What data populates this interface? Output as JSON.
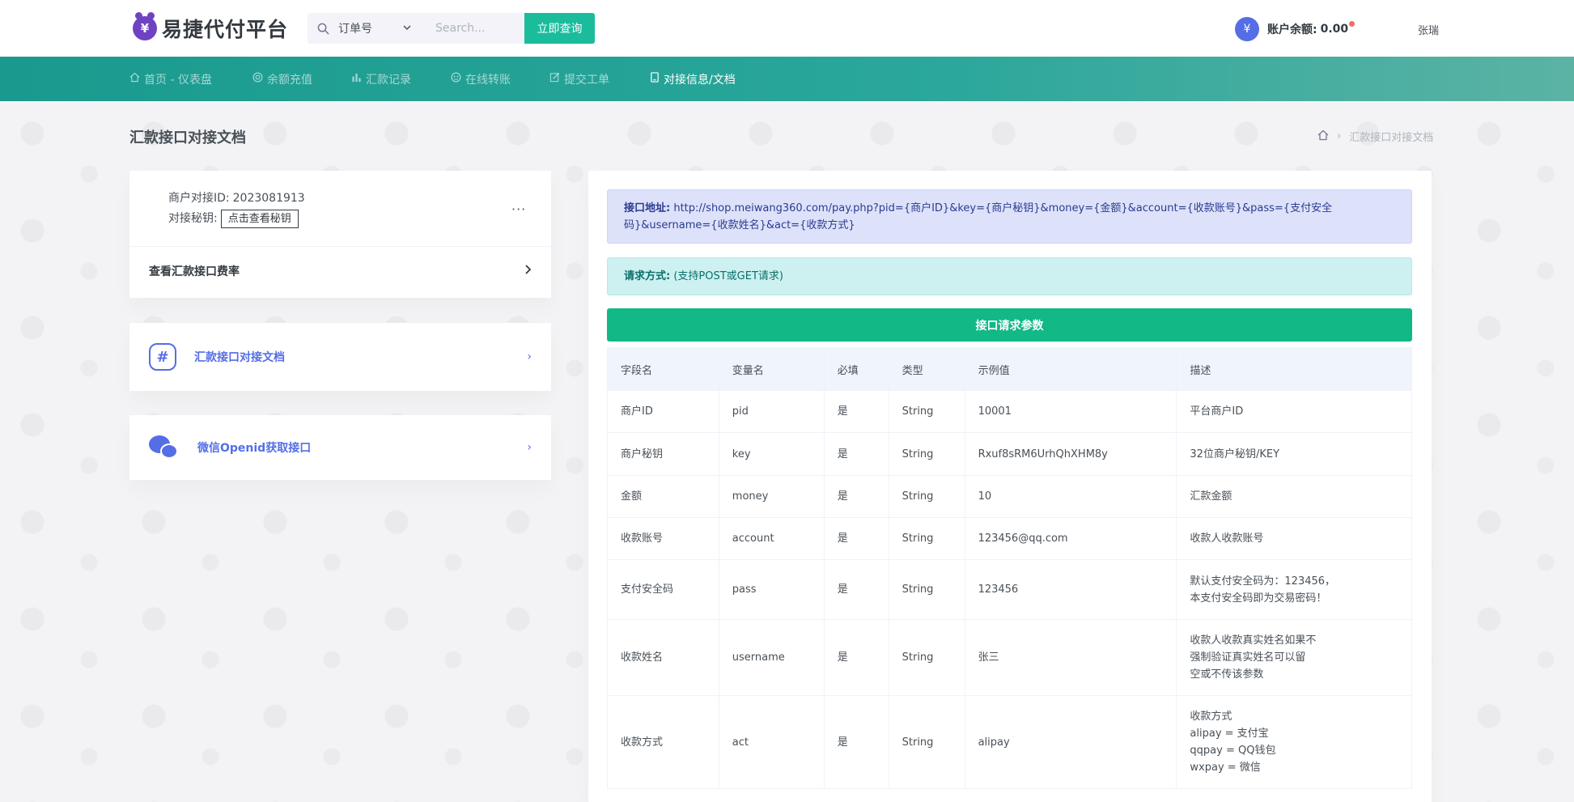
{
  "header": {
    "logo_text": "易捷代付平台",
    "search_select": "订单号",
    "search_placeholder": "Search...",
    "search_button": "立即查询",
    "balance_label": "账户余额:",
    "balance_value": "0.00",
    "user_name": "张瑞"
  },
  "nav": [
    {
      "label": "首页 - 仪表盘",
      "icon": "home-icon"
    },
    {
      "label": "余额充值",
      "icon": "coin-icon"
    },
    {
      "label": "汇款记录",
      "icon": "bar-chart-icon"
    },
    {
      "label": "在线转账",
      "icon": "transfer-icon"
    },
    {
      "label": "提交工单",
      "icon": "edit-icon"
    },
    {
      "label": "对接信息/文档",
      "icon": "document-icon"
    }
  ],
  "page": {
    "title": "汇款接口对接文档",
    "breadcrumb_current": "汇款接口对接文档"
  },
  "merchant": {
    "id_label": "商户对接ID:",
    "id_value": "2023081913",
    "secret_label": "对接秘钥:",
    "secret_button": "点击查看秘钥",
    "rate_label": "查看汇款接口费率"
  },
  "links": {
    "doc_label": "汇款接口对接文档",
    "openid_label": "微信Openid获取接口"
  },
  "api": {
    "addr_label": "接口地址:",
    "addr_value": "http://shop.meiwang360.com/pay.php?pid={商户ID}&key={商户秘钥}&money={金额}&account={收款账号}&pass={支付安全码}&username={收款姓名}&act={收款方式}",
    "method_label": "请求方式:",
    "method_value": "(支持POST或GET请求)",
    "params_title": "接口请求参数"
  },
  "table": {
    "headers": [
      "字段名",
      "变量名",
      "必填",
      "类型",
      "示例值",
      "描述"
    ],
    "rows": [
      {
        "field": "商户ID",
        "var": "pid",
        "required": "是",
        "type": "String",
        "example": "10001",
        "desc": [
          "平台商户ID"
        ]
      },
      {
        "field": "商户秘钥",
        "var": "key",
        "required": "是",
        "type": "String",
        "example": "Rxuf8sRM6UrhQhXHM8y",
        "desc": [
          "32位商户秘钥/KEY"
        ]
      },
      {
        "field": "金额",
        "var": "money",
        "required": "是",
        "type": "String",
        "example": "10",
        "desc": [
          "汇款金额"
        ]
      },
      {
        "field": "收款账号",
        "var": "account",
        "required": "是",
        "type": "String",
        "example": "123456@qq.com",
        "desc": [
          "收款人收款账号"
        ]
      },
      {
        "field": "支付安全码",
        "var": "pass",
        "required": "是",
        "type": "String",
        "example": "123456",
        "desc": [
          "默认支付安全码为：123456，",
          "本支付安全码即为交易密码！"
        ]
      },
      {
        "field": "收款姓名",
        "var": "username",
        "required": "是",
        "type": "String",
        "example": "张三",
        "desc": [
          "收款人收款真实姓名如果不",
          "强制验证真实姓名可以留",
          "空或不传该参数"
        ]
      },
      {
        "field": "收款方式",
        "var": "act",
        "required": "是",
        "type": "String",
        "example": "alipay",
        "desc": [
          "收款方式",
          "alipay = 支付宝",
          "qqpay = QQ钱包",
          "wxpay = 微信"
        ]
      }
    ]
  }
}
